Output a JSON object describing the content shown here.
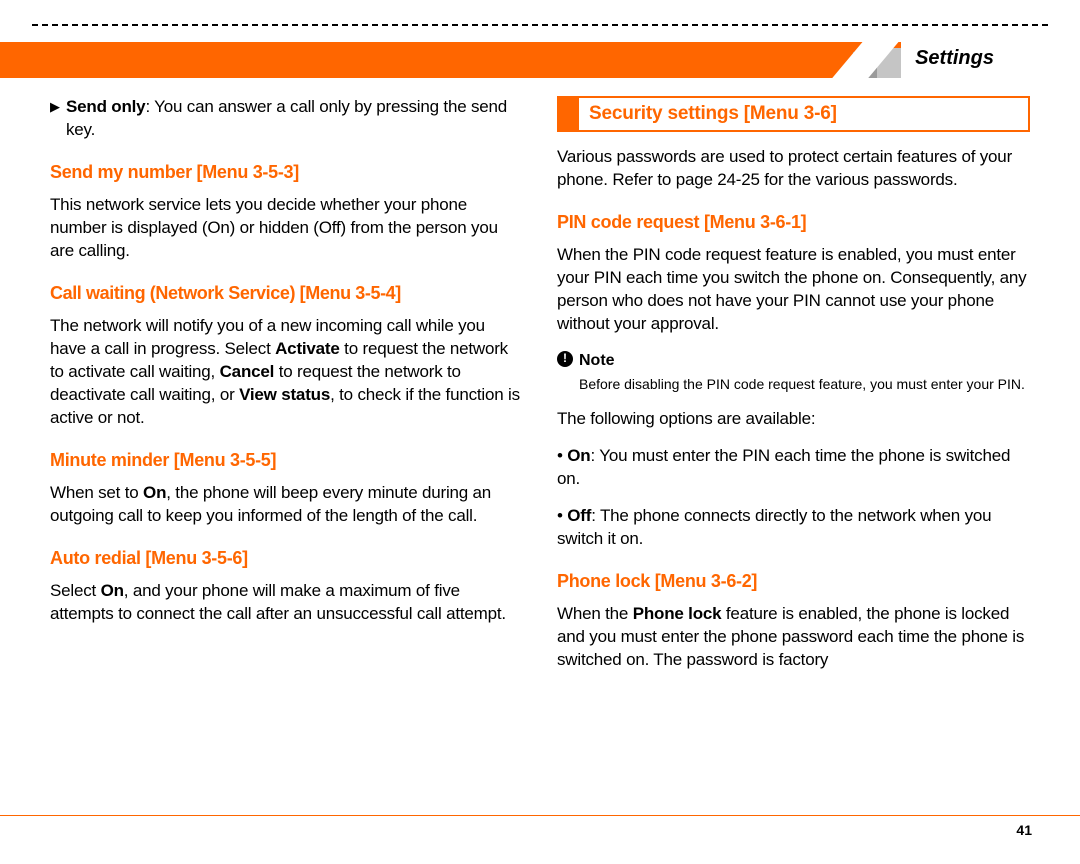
{
  "header": {
    "tab_label": "Settings"
  },
  "left": {
    "send_only_label": "Send only",
    "send_only_text": ": You can answer a call only by pressing the send key.",
    "send_my_number_head": "Send my number [Menu 3-5-3]",
    "send_my_number_text": "This network service lets you decide whether your phone number is displayed (On) or hidden (Off) from the person you are calling.",
    "call_waiting_head": "Call waiting (Network Service) [Menu 3-5-4]",
    "call_waiting_pre": "The network will notify you of a new incoming call while you have a call in progress. Select ",
    "activate": "Activate",
    "call_waiting_mid1": " to request the network to activate call waiting, ",
    "cancel": "Cancel",
    "call_waiting_mid2": " to request the network to deactivate call waiting, or ",
    "view_status": "View status",
    "call_waiting_end": ", to check if the function is active or not.",
    "minute_head": "Minute minder [Menu 3-5-5]",
    "minute_pre": "When set to ",
    "on": "On",
    "minute_end": ", the phone will beep every minute during an outgoing call to keep you informed of the length of the call.",
    "auto_redial_head": "Auto redial [Menu 3-5-6]",
    "auto_redial_pre": "Select ",
    "auto_redial_end": ", and your phone will make a maximum of five attempts to connect the call after an unsuccessful call attempt."
  },
  "right": {
    "section_title": "Security settings [Menu 3-6]",
    "intro": "Various passwords are used to protect certain features of your phone. Refer to page 24-25 for the various passwords.",
    "pin_head": "PIN code request [Menu 3-6-1]",
    "pin_text": "When the PIN code request feature is enabled, you must enter your PIN each time you switch the phone on. Consequently, any person who does not have your PIN cannot use your phone without your approval.",
    "note_label": "Note",
    "note_text": "Before disabling the PIN code request feature, you must enter your PIN.",
    "options_intro": "The following options are available:",
    "opt_on_label": "On",
    "opt_on_text": ": You must enter the PIN each time the phone is switched on.",
    "opt_off_label": "Off",
    "opt_off_text": ": The phone connects directly to the network when you switch it on.",
    "phone_lock_head": "Phone lock [Menu 3-6-2]",
    "phone_lock_pre": "When the ",
    "phone_lock_bold": "Phone lock",
    "phone_lock_end": " feature is enabled, the phone is locked and you must enter the phone password each time the phone is switched on. The password is factory"
  },
  "page_number": "41"
}
